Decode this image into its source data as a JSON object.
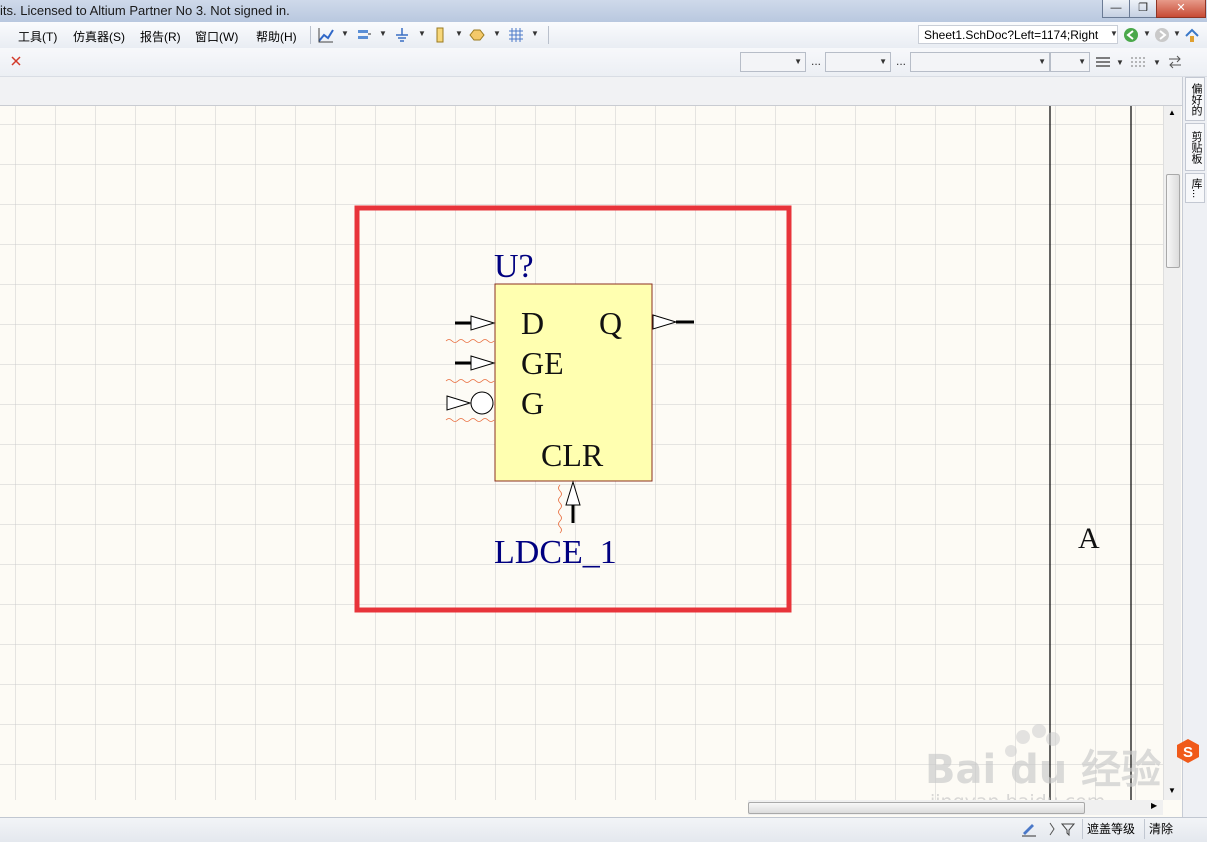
{
  "window": {
    "title": "its. Licensed to Altium Partner No 3. Not signed in.",
    "minimize_glyph": "—",
    "maximize_glyph": "❐",
    "close_glyph": "✕"
  },
  "menubar": {
    "items": [
      {
        "label": "工具(T)"
      },
      {
        "label": "仿真器(S)"
      },
      {
        "label": "报告(R)"
      },
      {
        "label": "窗口(W)"
      },
      {
        "label": "帮助(H)"
      }
    ],
    "address": "Sheet1.SchDoc?Left=1174;Right",
    "toolbar_icons": [
      "wire-tool-icon",
      "bus-tool-icon",
      "ground-power-icon",
      "part-place-icon",
      "net-label-icon",
      "grid-icon"
    ]
  },
  "toolbar2": {
    "dots": [
      "...",
      "..."
    ]
  },
  "sidepanel": {
    "tabs": [
      {
        "label": "偏好的"
      },
      {
        "label": "剪贴板"
      },
      {
        "label": "库..."
      }
    ]
  },
  "schematic": {
    "designator": "U?",
    "comment": "LDCE_1",
    "pins": [
      {
        "label": "D"
      },
      {
        "label": "GE"
      },
      {
        "label": "G"
      },
      {
        "label": "Q"
      },
      {
        "label": "CLR"
      }
    ],
    "zone_label": "A",
    "colors": {
      "body_fill": "#ffffb0",
      "body_stroke": "#8b2f20",
      "highlight": "#e8343a",
      "designator_text": "#000080"
    }
  },
  "statusbar": {
    "buttons": [
      {
        "label": "遮盖等级"
      },
      {
        "label": "清除"
      }
    ]
  },
  "watermark": {
    "brand": "Bai du 经验",
    "url": "jingyan.baidu.com"
  }
}
